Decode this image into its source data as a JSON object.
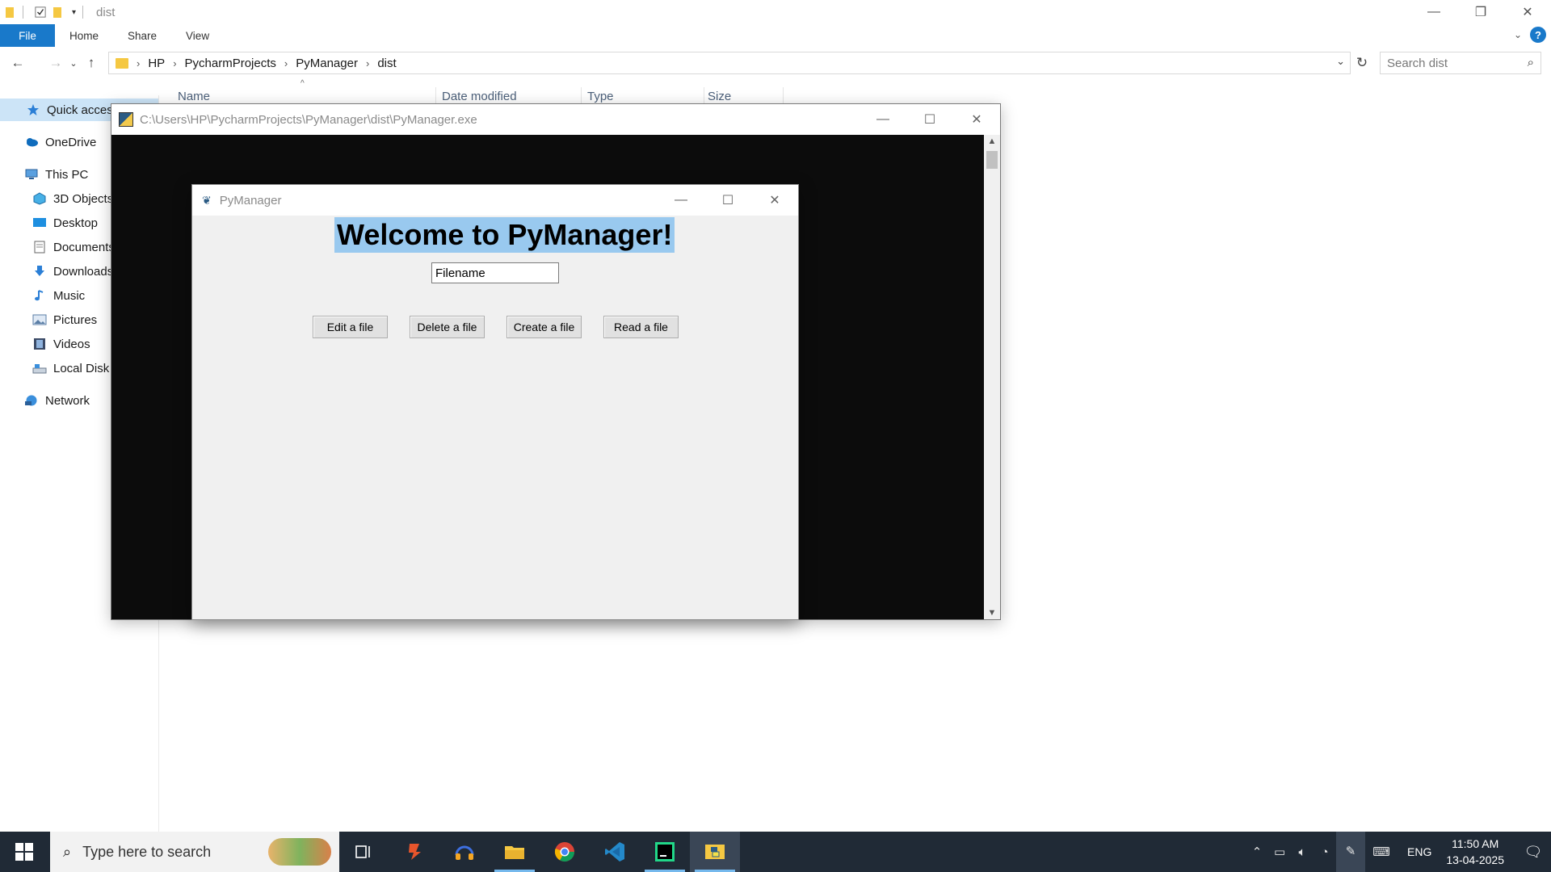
{
  "explorer": {
    "title": "dist",
    "window_controls": {
      "minimize": "—",
      "restore": "❐",
      "close": "✕"
    },
    "ribbon_tabs": [
      "File",
      "Home",
      "Share",
      "View"
    ],
    "ribbon_help": "?",
    "breadcrumbs": [
      "HP",
      "PycharmProjects",
      "PyManager",
      "dist"
    ],
    "search_placeholder": "Search dist",
    "nav_pane": {
      "quick_access": "Quick access",
      "onedrive": "OneDrive",
      "this_pc": "This PC",
      "objects_3d": "3D Objects",
      "desktop": "Desktop",
      "documents": "Documents",
      "downloads": "Downloads",
      "music": "Music",
      "pictures": "Pictures",
      "videos": "Videos",
      "local_disk": "Local Disk",
      "network": "Network"
    },
    "columns": {
      "name": "Name",
      "date_modified": "Date modified",
      "type": "Type",
      "size": "Size"
    }
  },
  "console": {
    "title": "C:\\Users\\HP\\PycharmProjects\\PyManager\\dist\\PyManager.exe"
  },
  "pymanager": {
    "title": "PyManager",
    "heading": "Welcome to PyManager!",
    "filename_value": "Filename",
    "buttons": {
      "edit": "Edit a file",
      "delete": "Delete a file",
      "create": "Create a file",
      "read": "Read a file"
    }
  },
  "taskbar": {
    "search_placeholder": "Type here to search",
    "language": "ENG",
    "time": "11:50 AM",
    "date": "13-04-2025"
  },
  "colors": {
    "accent": "#1979ca",
    "taskbar": "#202a36",
    "selection": "#99c9ef"
  }
}
